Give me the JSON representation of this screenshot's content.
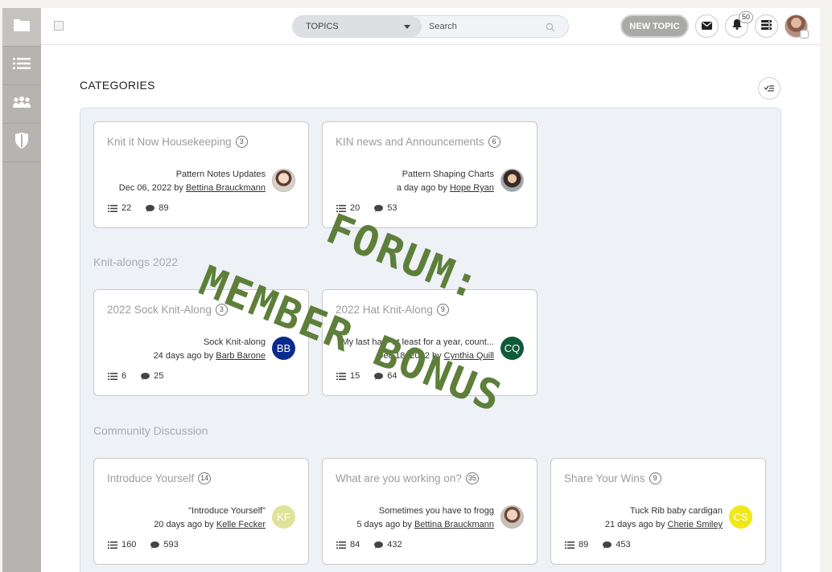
{
  "sidebar": {
    "items": [
      {
        "icon": "folder-icon"
      },
      {
        "icon": "list-icon"
      },
      {
        "icon": "users-icon"
      },
      {
        "icon": "shield-icon"
      }
    ]
  },
  "header": {
    "search": {
      "select_value": "TOPICS",
      "placeholder": "Search"
    },
    "new_topic_label": "NEW TOPIC",
    "notifications_count": "50"
  },
  "categories": {
    "title": "CATEGORIES",
    "groups": [
      {
        "title": "",
        "cards": [
          {
            "title": "Knit it Now Housekeeping",
            "count": "3",
            "post_title": "Pattern Notes Updates",
            "meta_prefix": "Dec 06, 2022 by ",
            "author": "Bettina Brauckmann",
            "avatar_initials": "",
            "topics": "22",
            "comments": "89"
          },
          {
            "title": "KIN news and Announcements",
            "count": "6",
            "post_title": "Pattern Shaping Charts",
            "meta_prefix": "a day ago by ",
            "author": "Hope Ryan",
            "avatar_initials": "",
            "topics": "20",
            "comments": "53"
          }
        ]
      },
      {
        "title": "Knit-alongs 2022",
        "cards": [
          {
            "title": "2022 Sock Knit-Along",
            "count": "3",
            "post_title": "Sock Knit-along",
            "meta_prefix": "24 days ago by ",
            "author": "Barb Barone",
            "avatar_initials": "BB",
            "topics": "6",
            "comments": "25"
          },
          {
            "title": "2022 Hat Knit-Along",
            "count": "9",
            "post_title": "My last hat - at least for a year, count...",
            "meta_prefix": "Dec 18, 2022 by ",
            "author": "Cynthia Quill",
            "avatar_initials": "CQ",
            "topics": "15",
            "comments": "64"
          }
        ]
      },
      {
        "title": "Community Discussion",
        "cards": [
          {
            "title": "Introduce Yourself",
            "count": "14",
            "post_title": "\"Introduce Yourself\"",
            "meta_prefix": "20 days ago by ",
            "author": "Kelle Fecker",
            "avatar_initials": "KF",
            "topics": "160",
            "comments": "593"
          },
          {
            "title": "What are you working on?",
            "count": "35",
            "post_title": "Sometimes you have to frogg",
            "meta_prefix": "5 days ago by ",
            "author": "Bettina Brauckmann",
            "avatar_initials": "",
            "topics": "84",
            "comments": "432"
          },
          {
            "title": "Share Your Wins",
            "count": "9",
            "post_title": "Tuck Rib baby cardigan",
            "meta_prefix": "21 days ago by ",
            "author": "Cherie Smiley",
            "avatar_initials": "CS",
            "topics": "89",
            "comments": "453"
          }
        ]
      }
    ]
  },
  "watermark": {
    "line1": "FORUM:",
    "line2": "MEMBER BONUS",
    "color": "#5d7f3a"
  },
  "colors": {
    "bb": "#0a2a8c",
    "cq": "#0f5a3a",
    "kf": "#dfe39a",
    "cs": "#f1e81a"
  }
}
